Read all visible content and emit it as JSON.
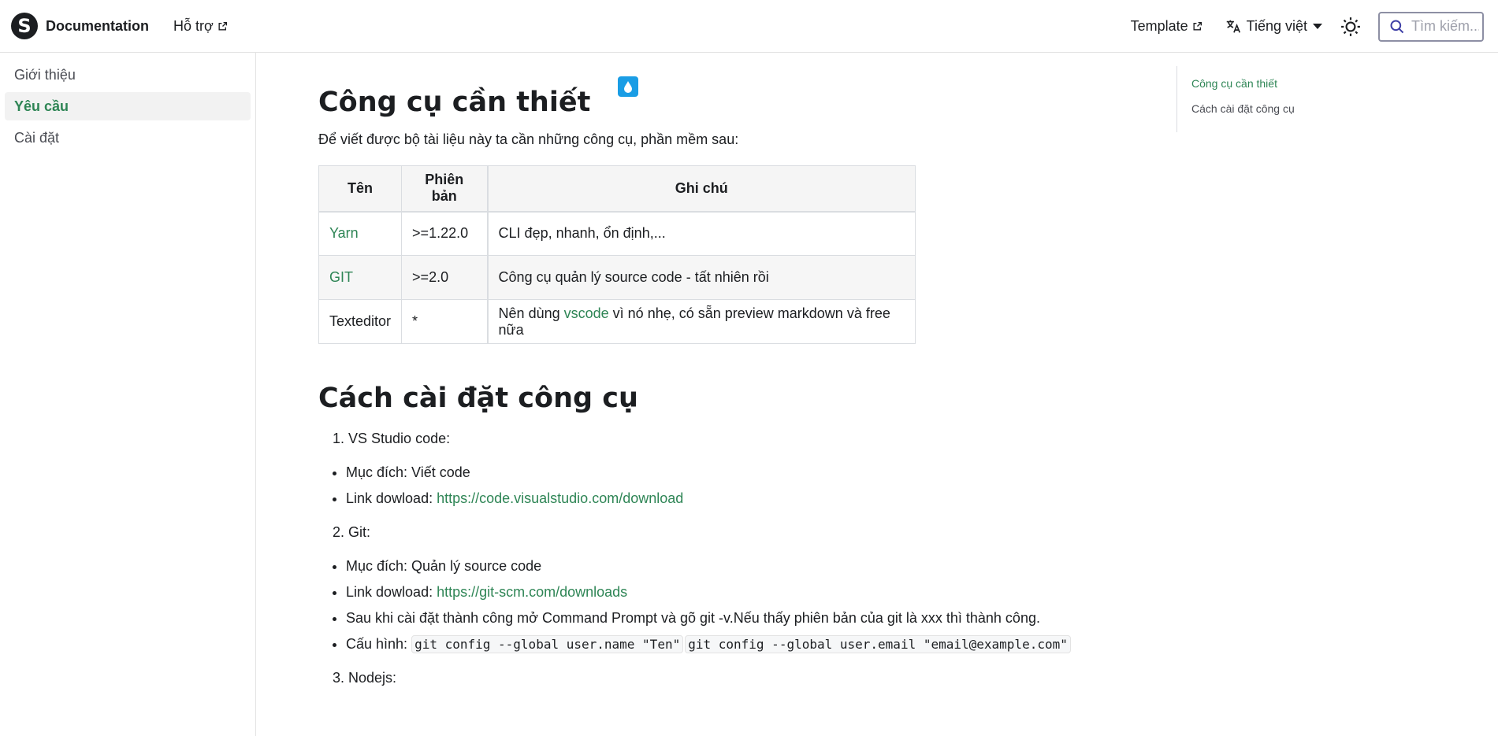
{
  "navbar": {
    "logo_letter": "S",
    "brand_title": "Documentation",
    "support_link": "Hỗ trợ",
    "template_link": "Template",
    "language": "Tiếng việt",
    "search_placeholder": "Tìm kiếm..."
  },
  "sidebar": {
    "items": [
      {
        "label": "Giới thiệu"
      },
      {
        "label": "Yêu cầu"
      },
      {
        "label": "Cài đặt"
      }
    ]
  },
  "main": {
    "title": "Công cụ cần thiết",
    "intro": "Để viết được bộ tài liệu này ta cần những công cụ, phần mềm sau:",
    "table": {
      "headers": [
        "Tên",
        "Phiên bản",
        "Ghi chú"
      ],
      "rows": [
        {
          "name": "Yarn",
          "version": ">=1.22.0",
          "note": "CLI đẹp, nhanh, ổn định,..."
        },
        {
          "name": "GIT",
          "version": ">=2.0",
          "note": "Công cụ quản lý source code - tất nhiên rồi"
        },
        {
          "name": "Texteditor",
          "version": "*",
          "note_before": "Nên dùng ",
          "note_link": "vscode",
          "note_after": " vì nó nhẹ, có sẵn preview markdown và free nữa"
        }
      ]
    },
    "section_title": "Cách cài đặt công cụ",
    "steps": [
      {
        "label": "1. VS Studio code:",
        "purpose": "Mục đích: Viết code",
        "link_prefix": "Link dowload: ",
        "link": "https://code.visualstudio.com/download"
      },
      {
        "label": "2. Git:",
        "purpose": "Mục đích: Quản lý source code",
        "link_prefix": "Link dowload: ",
        "link": "https://git-scm.com/downloads",
        "after_install": "Sau khi cài đặt thành công mở Command Prompt và gõ git -v.Nếu thấy phiên bản của git là xxx thì thành công.",
        "config_prefix": "Cấu hình: ",
        "config_code_1": "git config --global user.name \"Ten\"",
        "config_code_2": "git config --global user.email \"email@example.com\""
      },
      {
        "label": "3. Nodejs:"
      }
    ]
  },
  "toc": {
    "items": [
      {
        "label": "Công cụ cần thiết"
      },
      {
        "label": "Cách cài đặt công cụ"
      }
    ]
  },
  "colors": {
    "accent": "#2e8555",
    "droplet": "#1a9de5",
    "search_border": "#8d8fa4"
  },
  "icons": [
    "external-link-icon",
    "translate-icon",
    "chevron-down-icon",
    "sun-icon",
    "search-icon",
    "droplet-icon"
  ]
}
